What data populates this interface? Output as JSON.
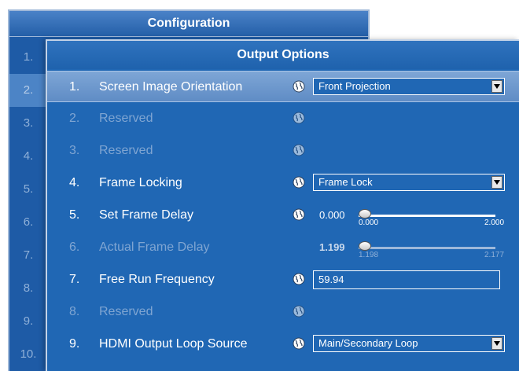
{
  "config": {
    "title": "Configuration",
    "numbers": [
      "1.",
      "2.",
      "3.",
      "4.",
      "5.",
      "6.",
      "7.",
      "8.",
      "9.",
      "10."
    ],
    "selected_index": 1
  },
  "output": {
    "title": "Output Options",
    "rows": [
      {
        "num": "1.",
        "label": "Screen Image Orientation",
        "control": "dropdown",
        "value": "Front Projection",
        "enabled": true,
        "selected": true
      },
      {
        "num": "2.",
        "label": "Reserved",
        "control": "none",
        "enabled": false
      },
      {
        "num": "3.",
        "label": "Reserved",
        "control": "none",
        "enabled": false
      },
      {
        "num": "4.",
        "label": "Frame Locking",
        "control": "dropdown",
        "value": "Frame Lock",
        "enabled": true
      },
      {
        "num": "5.",
        "label": "Set Frame Delay",
        "control": "slider",
        "value": "0.000",
        "min": "0.000",
        "max": "2.000",
        "fraction": 0.0,
        "enabled": true
      },
      {
        "num": "6.",
        "label": "Actual Frame Delay",
        "control": "slider",
        "value": "1.199",
        "min": "1.198",
        "max": "2.177",
        "fraction": 0.0,
        "enabled": false
      },
      {
        "num": "7.",
        "label": "Free Run Frequency",
        "control": "text",
        "value": "59.94",
        "enabled": true
      },
      {
        "num": "8.",
        "label": "Reserved",
        "control": "none",
        "enabled": false
      },
      {
        "num": "9.",
        "label": "HDMI Output Loop Source",
        "control": "dropdown",
        "value": "Main/Secondary Loop",
        "enabled": true
      }
    ]
  },
  "icons": {
    "row_icon": "globe-icon",
    "dropdown_icon": "chevron-down-icon"
  },
  "colors": {
    "panel_bg": "#2067b4",
    "selected_row": "#6f98cc",
    "disabled_text": "#7fa5d2"
  }
}
